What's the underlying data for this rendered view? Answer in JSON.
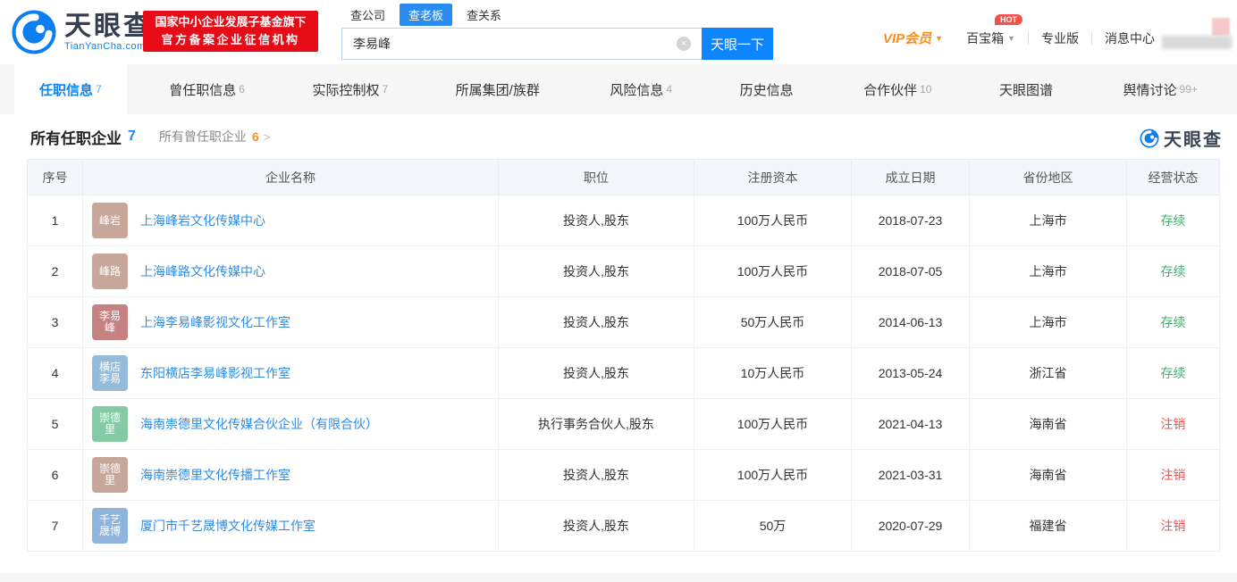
{
  "header": {
    "logo": {
      "name": "天眼查",
      "domain": "TianYanCha.com"
    },
    "badge": {
      "line1": "国家中小企业发展子基金旗下",
      "line2": "官方备案企业征信机构"
    },
    "search": {
      "tabs": [
        {
          "label": "查公司",
          "active": false
        },
        {
          "label": "查老板",
          "active": true
        },
        {
          "label": "查关系",
          "active": false
        }
      ],
      "value": "李易峰",
      "clear_icon": "×",
      "button": "天眼一下"
    },
    "nav": {
      "vip": "VIP会员",
      "toolbox": "百宝箱",
      "hot": "HOT",
      "pro": "专业版",
      "messages": "消息中心"
    }
  },
  "tabs": [
    {
      "label": "任职信息",
      "count": "7",
      "active": true
    },
    {
      "label": "曾任职信息",
      "count": "6",
      "active": false
    },
    {
      "label": "实际控制权",
      "count": "7",
      "active": false
    },
    {
      "label": "所属集团/族群",
      "count": "",
      "active": false
    },
    {
      "label": "风险信息",
      "count": "4",
      "active": false
    },
    {
      "label": "历史信息",
      "count": "",
      "active": false
    },
    {
      "label": "合作伙伴",
      "count": "10",
      "active": false
    },
    {
      "label": "天眼图谱",
      "count": "",
      "active": false
    },
    {
      "label": "舆情讨论",
      "count": "99+",
      "active": false
    }
  ],
  "section": {
    "title": "所有任职企业",
    "title_count": "7",
    "secondary": "所有曾任职企业",
    "secondary_count": "6",
    "arrow": "&gt;",
    "watermark": "天眼查"
  },
  "table": {
    "headers": [
      "序号",
      "企业名称",
      "职位",
      "注册资本",
      "成立日期",
      "省份地区",
      "经营状态"
    ],
    "rows": [
      {
        "no": "1",
        "avatar": {
          "lines": [
            "峰岩"
          ],
          "color": "#c8a79b"
        },
        "company": "上海峰岩文化传媒中心",
        "position": "投资人,股东",
        "capital": "100万人民币",
        "date": "2018-07-23",
        "region": "上海市",
        "status": "存续",
        "status_type": "active"
      },
      {
        "no": "2",
        "avatar": {
          "lines": [
            "峰路"
          ],
          "color": "#c8a79b"
        },
        "company": "上海峰路文化传媒中心",
        "position": "投资人,股东",
        "capital": "100万人民币",
        "date": "2018-07-05",
        "region": "上海市",
        "status": "存续",
        "status_type": "active"
      },
      {
        "no": "3",
        "avatar": {
          "lines": [
            "李易",
            "峰"
          ],
          "color": "#c68181"
        },
        "company": "上海李易峰影视文化工作室",
        "position": "投资人,股东",
        "capital": "50万人民币",
        "date": "2014-06-13",
        "region": "上海市",
        "status": "存续",
        "status_type": "active"
      },
      {
        "no": "4",
        "avatar": {
          "lines": [
            "横店",
            "李易"
          ],
          "color": "#95bbdb"
        },
        "company": "东阳横店李易峰影视工作室",
        "position": "投资人,股东",
        "capital": "10万人民币",
        "date": "2013-05-24",
        "region": "浙江省",
        "status": "存续",
        "status_type": "active"
      },
      {
        "no": "5",
        "avatar": {
          "lines": [
            "崇德",
            "里"
          ],
          "color": "#84caa4"
        },
        "company": "海南崇德里文化传媒合伙企业（有限合伙）",
        "position": "执行事务合伙人,股东",
        "capital": "100万人民币",
        "date": "2021-04-13",
        "region": "海南省",
        "status": "注销",
        "status_type": "cancelled"
      },
      {
        "no": "6",
        "avatar": {
          "lines": [
            "崇德",
            "里"
          ],
          "color": "#c8a79b"
        },
        "company": "海南崇德里文化传播工作室",
        "position": "投资人,股东",
        "capital": "100万人民币",
        "date": "2021-03-31",
        "region": "海南省",
        "status": "注销",
        "status_type": "cancelled"
      },
      {
        "no": "7",
        "avatar": {
          "lines": [
            "千艺",
            "晟博"
          ],
          "color": "#8fb5dd"
        },
        "company": "厦门市千艺晟博文化传媒工作室",
        "position": "投资人,股东",
        "capital": "50万",
        "date": "2020-07-29",
        "region": "福建省",
        "status": "注销",
        "status_type": "cancelled"
      }
    ]
  },
  "colors": {
    "brand_blue": "#0b84f5",
    "link_blue": "#2d8ce6",
    "badge_red": "#e60b17",
    "vip_orange": "#ff8d1a",
    "status_green": "#3db370",
    "status_red": "#f05555"
  }
}
